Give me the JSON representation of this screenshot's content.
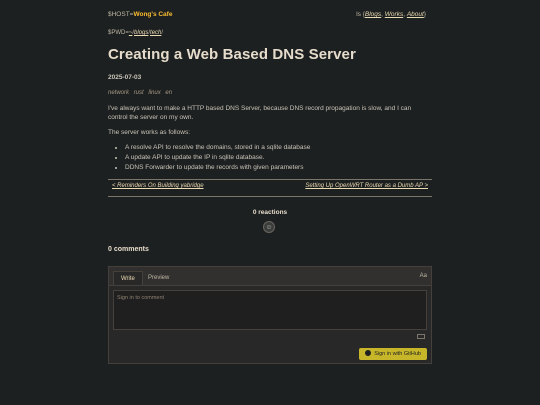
{
  "header": {
    "host_prefix": "$HOST=",
    "site_name": "Wong's Cafe",
    "nav_prefix": "ls {",
    "nav_links": [
      "Blogs",
      "Works",
      "About"
    ],
    "nav_suffix": "}",
    "pwd_prefix": "$PWD=",
    "pwd_parts": [
      "~",
      "/",
      "blogs",
      "/",
      "tech",
      "/"
    ]
  },
  "post": {
    "title": "Creating a Web Based DNS Server",
    "date": "2025-07-03",
    "tags": [
      "network",
      "rust",
      "linux",
      "en"
    ],
    "paragraph1": "I've always want to make a HTTP based DNS Server, because DNS record propagation is slow, and I can control the server on my own.",
    "paragraph2": "The server works as follows:",
    "list": [
      "A resolve API to resolve the domains, stored in a sqlite database",
      "A update API to update the IP in sqlite database.",
      "DDNS Forwarder to update the records with given parameters"
    ]
  },
  "pager": {
    "prev": "< Reminders On Building yabridge",
    "next": "Setting Up OpenWRT Router as a Dumb AP >"
  },
  "reactions": {
    "label": "0 reactions",
    "smiley": "☺"
  },
  "comments": {
    "count_label": "0 comments",
    "tab_write": "Write",
    "tab_preview": "Preview",
    "aa": "Aa",
    "placeholder": "Sign in to comment",
    "signin_button": "Sign in with GitHub"
  }
}
